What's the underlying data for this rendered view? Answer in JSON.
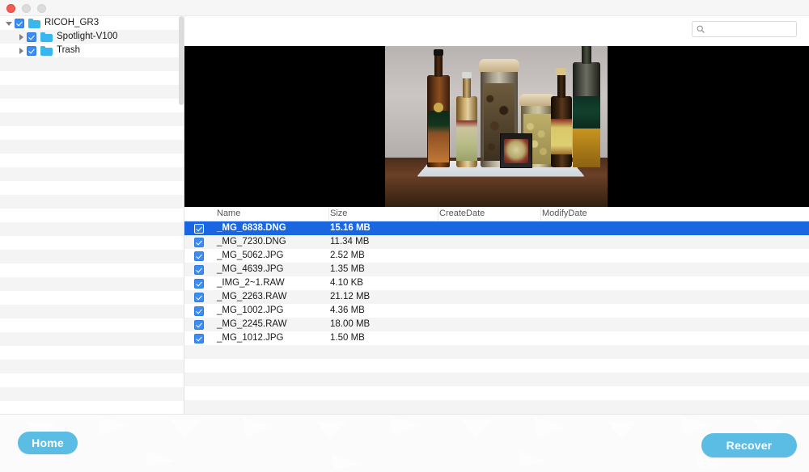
{
  "window": {
    "controls": [
      "close",
      "minimize",
      "maximize"
    ]
  },
  "sidebar": {
    "tree": [
      {
        "label": "RICOH_GR3",
        "level": 0,
        "expanded": true,
        "checked": true,
        "disclosure": "triangle-down"
      },
      {
        "label": "Spotlight-V100",
        "level": 1,
        "expanded": false,
        "checked": true,
        "disclosure": "triangle-right"
      },
      {
        "label": "Trash",
        "level": 1,
        "expanded": false,
        "checked": true,
        "disclosure": "triangle-right"
      }
    ]
  },
  "toolbar": {
    "search": {
      "value": "",
      "placeholder": "",
      "icon": "search-icon"
    }
  },
  "preview": {
    "alt": "Photo preview of glass bottles and jars on a wooden table",
    "background": "#000000"
  },
  "filelist": {
    "columns": [
      {
        "key": "name",
        "label": "Name"
      },
      {
        "key": "size",
        "label": "Size"
      },
      {
        "key": "createdate",
        "label": "CreateDate"
      },
      {
        "key": "modifydate",
        "label": "ModifyDate"
      }
    ],
    "rows": [
      {
        "checked": true,
        "name": "_MG_6838.DNG",
        "size": "15.16 MB",
        "createdate": "",
        "modifydate": "",
        "selected": true
      },
      {
        "checked": true,
        "name": "_MG_7230.DNG",
        "size": "11.34 MB",
        "createdate": "",
        "modifydate": "",
        "selected": false
      },
      {
        "checked": true,
        "name": "_MG_5062.JPG",
        "size": "2.52 MB",
        "createdate": "",
        "modifydate": "",
        "selected": false
      },
      {
        "checked": true,
        "name": "_MG_4639.JPG",
        "size": "1.35 MB",
        "createdate": "",
        "modifydate": "",
        "selected": false
      },
      {
        "checked": true,
        "name": "_IMG_2~1.RAW",
        "size": "4.10 KB",
        "createdate": "",
        "modifydate": "",
        "selected": false
      },
      {
        "checked": true,
        "name": "_MG_2263.RAW",
        "size": "21.12 MB",
        "createdate": "",
        "modifydate": "",
        "selected": false
      },
      {
        "checked": true,
        "name": "_MG_1002.JPG",
        "size": "4.36 MB",
        "createdate": "",
        "modifydate": "",
        "selected": false
      },
      {
        "checked": true,
        "name": "_MG_2245.RAW",
        "size": "18.00 MB",
        "createdate": "",
        "modifydate": "",
        "selected": false
      },
      {
        "checked": true,
        "name": "_MG_1012.JPG",
        "size": "1.50 MB",
        "createdate": "",
        "modifydate": "",
        "selected": false
      }
    ]
  },
  "footer": {
    "home_label": "Home",
    "recover_label": "Recover"
  },
  "colors": {
    "accent_button": "#5bbde4",
    "selection": "#1a66e0",
    "checkbox": "#3b8cf5",
    "folder": "#37b6f0",
    "row_alt": "#f4f4f4"
  }
}
